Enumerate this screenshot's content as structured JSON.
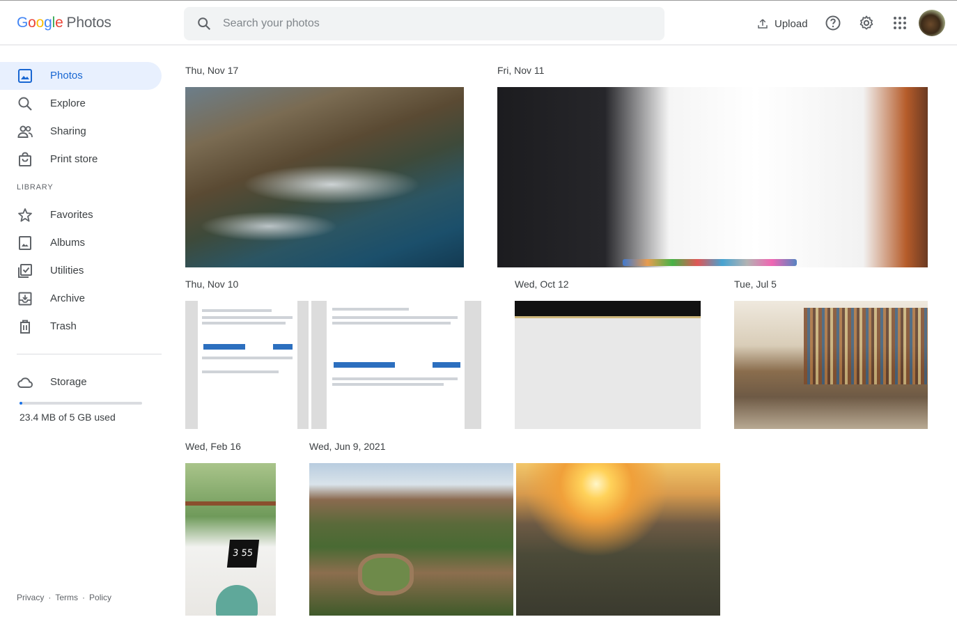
{
  "app": {
    "logo_google": [
      "G",
      "o",
      "o",
      "g",
      "l",
      "e"
    ],
    "logo_product": "Photos"
  },
  "search": {
    "placeholder": "Search your photos"
  },
  "toolbar": {
    "upload_label": "Upload"
  },
  "sidebar": {
    "items": [
      {
        "label": "Photos",
        "icon": "photo-icon"
      },
      {
        "label": "Explore",
        "icon": "search-icon"
      },
      {
        "label": "Sharing",
        "icon": "people-icon"
      },
      {
        "label": "Print store",
        "icon": "bag-icon"
      }
    ],
    "library_title": "LIBRARY",
    "library_items": [
      {
        "label": "Favorites",
        "icon": "star-icon"
      },
      {
        "label": "Albums",
        "icon": "album-icon"
      },
      {
        "label": "Utilities",
        "icon": "utilities-icon"
      },
      {
        "label": "Archive",
        "icon": "archive-icon"
      },
      {
        "label": "Trash",
        "icon": "trash-icon"
      }
    ],
    "storage_label": "Storage",
    "storage_used": "23.4 MB of 5 GB used",
    "storage_fraction": 0.005
  },
  "footer": {
    "privacy": "Privacy",
    "terms": "Terms",
    "policy": "Policy",
    "sep": "·"
  },
  "groups": [
    {
      "date": "Thu, Nov 17"
    },
    {
      "date": "Fri, Nov 11"
    },
    {
      "date": "Thu, Nov 10"
    },
    {
      "date": "Wed, Oct 12"
    },
    {
      "date": "Tue, Jul 5"
    },
    {
      "date": "Wed, Feb 16"
    },
    {
      "date": "Wed, Jun 9, 2021"
    }
  ],
  "photo_text": {
    "clock": "3 55"
  },
  "colors": {
    "accent": "#1a73e8",
    "active_bg": "#e8f0fe",
    "active_text": "#1967d2"
  }
}
